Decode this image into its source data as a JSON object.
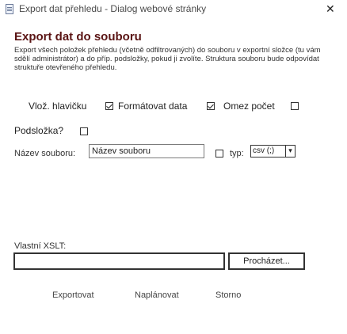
{
  "window": {
    "title": "Export dat přehledu - Dialog webové stránky",
    "close_glyph": "✕"
  },
  "heading": "Export dat do souboru",
  "description": "Export všech položek přehledu (včetně odfiltrovaných) do souboru v exportní složce (tu vám sdělí administrátor) a do příp. podsložky, pokud ji zvolíte. Struktura souboru bude odpovídat struktuře otevřeného přehledu.",
  "options": {
    "header_label": "Vlož. hlavičku",
    "header_checked": true,
    "format_label": "Formátovat data",
    "format_checked": true,
    "limit_label": "Omez počet",
    "limit_checked": false,
    "subfolder_label": "Podsložka?",
    "subfolder_checked": false
  },
  "file": {
    "label": "Název souboru:",
    "value": "Název souboru",
    "type_checked": false,
    "type_label": "typ:",
    "type_value": "csv (;)",
    "dropdown_glyph": "▾"
  },
  "xslt": {
    "label": "Vlastní XSLT:",
    "value": "",
    "browse_label": "Procházet..."
  },
  "actions": {
    "export": "Exportovat",
    "schedule": "Naplánovat",
    "cancel": "Storno"
  }
}
